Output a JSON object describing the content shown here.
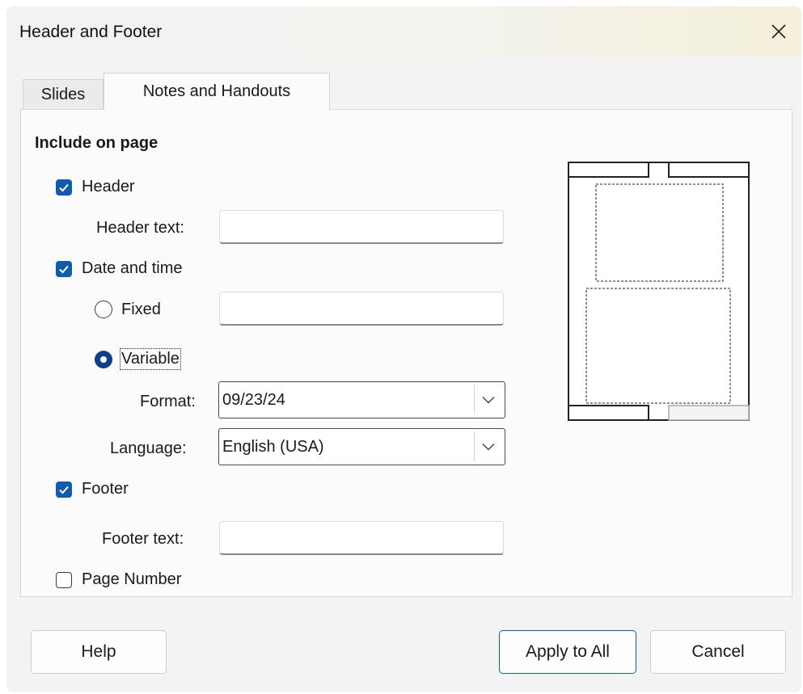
{
  "window": {
    "title": "Header and Footer"
  },
  "tabs": [
    {
      "label": "Slides",
      "active": false
    },
    {
      "label": "Notes and Handouts",
      "active": true
    }
  ],
  "include": {
    "section_title": "Include on page",
    "header": {
      "label": "Header",
      "checked": true,
      "text_label": "Header text:",
      "text_value": ""
    },
    "date_time": {
      "label": "Date and time",
      "checked": true,
      "fixed": {
        "label": "Fixed",
        "selected": false,
        "value": ""
      },
      "variable": {
        "label": "Variable",
        "selected": true
      },
      "format": {
        "label": "Format:",
        "value": "09/23/24"
      },
      "language": {
        "label": "Language:",
        "value": "English (USA)"
      }
    },
    "footer": {
      "label": "Footer",
      "checked": true,
      "text_label": "Footer text:",
      "text_value": ""
    },
    "page_number": {
      "label": "Page Number",
      "checked": false
    }
  },
  "buttons": {
    "help": "Help",
    "apply_all": "Apply to All",
    "cancel": "Cancel"
  },
  "colors": {
    "accent": "#0e5cad",
    "radio_accent": "#0e3f88"
  }
}
